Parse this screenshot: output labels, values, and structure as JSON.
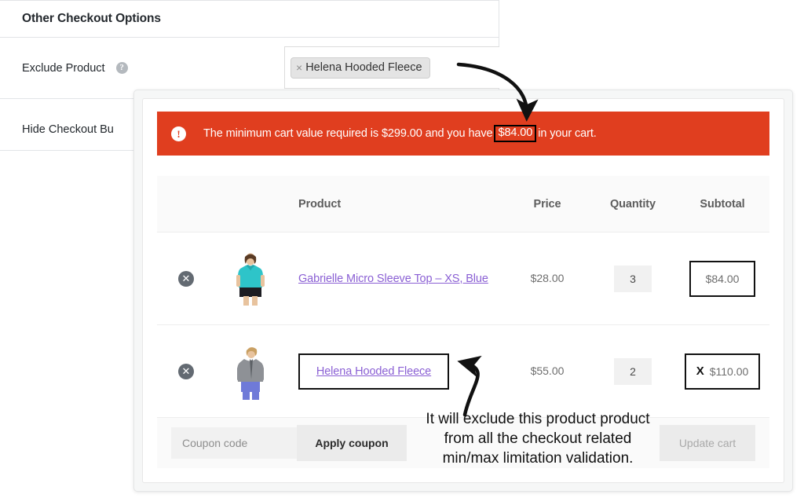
{
  "settings": {
    "header_title": "Other Checkout Options",
    "rows": [
      {
        "label": "Exclude Product",
        "help_icon": "question-mark-help-icon"
      },
      {
        "label": "Hide Checkout Bu"
      }
    ],
    "exclude_product_tag": {
      "remove_glyph": "×",
      "label": "Helena Hooded Fleece"
    }
  },
  "cart": {
    "notice": {
      "icon": "exclamation-icon",
      "text_before": "The minimum cart value required is $299.00 and you have",
      "highlighted_value": "$84.00",
      "text_after": "in your cart."
    },
    "table": {
      "headers": {
        "product": "Product",
        "price": "Price",
        "quantity": "Quantity",
        "subtotal": "Subtotal"
      },
      "rows": [
        {
          "remove_glyph": "✕",
          "thumb": "woman-teal-tshirt-photo",
          "name": "Gabrielle Micro Sleeve Top – XS, Blue",
          "price": "$28.00",
          "quantity": "3",
          "subtotal": "$84.00",
          "subtotal_marker": "",
          "highlight_subtotal": true,
          "highlight_name": false
        },
        {
          "remove_glyph": "✕",
          "thumb": "woman-gray-hoodie-photo",
          "name": "Helena Hooded Fleece",
          "price": "$55.00",
          "quantity": "2",
          "subtotal": "$110.00",
          "subtotal_marker": "X",
          "highlight_subtotal": true,
          "highlight_name": true
        }
      ]
    },
    "footer": {
      "coupon_placeholder": "Coupon code",
      "coupon_value": "",
      "apply_label": "Apply coupon",
      "update_label": "Update cart"
    }
  },
  "annotation": {
    "line1": "It will exclude this product product",
    "line2": "from all the checkout related",
    "line3": "min/max limitation validation."
  },
  "colors": {
    "notice_bg": "#e03e1f",
    "link": "#8a5fd4",
    "callout_outline": "#111111",
    "panel_bg": "#f6f7f7"
  }
}
